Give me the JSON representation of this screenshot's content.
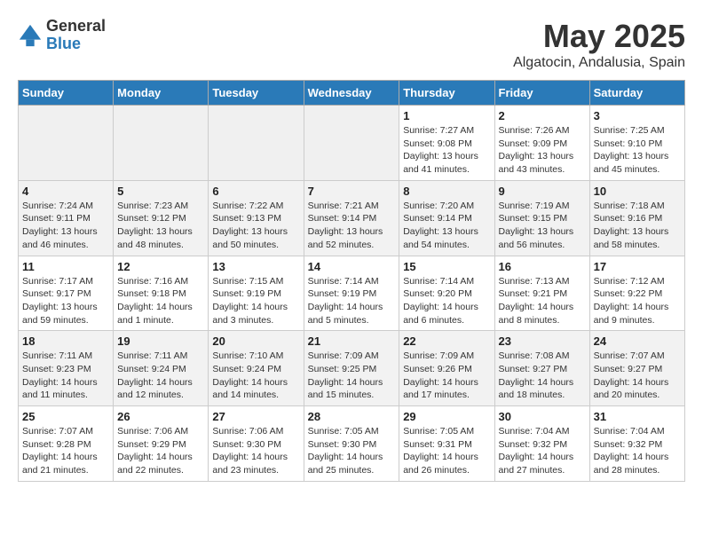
{
  "header": {
    "logo_general": "General",
    "logo_blue": "Blue",
    "month_title": "May 2025",
    "location": "Algatocin, Andalusia, Spain"
  },
  "days_of_week": [
    "Sunday",
    "Monday",
    "Tuesday",
    "Wednesday",
    "Thursday",
    "Friday",
    "Saturday"
  ],
  "weeks": [
    [
      {
        "day": "",
        "info": ""
      },
      {
        "day": "",
        "info": ""
      },
      {
        "day": "",
        "info": ""
      },
      {
        "day": "",
        "info": ""
      },
      {
        "day": "1",
        "info": "Sunrise: 7:27 AM\nSunset: 9:08 PM\nDaylight: 13 hours\nand 41 minutes."
      },
      {
        "day": "2",
        "info": "Sunrise: 7:26 AM\nSunset: 9:09 PM\nDaylight: 13 hours\nand 43 minutes."
      },
      {
        "day": "3",
        "info": "Sunrise: 7:25 AM\nSunset: 9:10 PM\nDaylight: 13 hours\nand 45 minutes."
      }
    ],
    [
      {
        "day": "4",
        "info": "Sunrise: 7:24 AM\nSunset: 9:11 PM\nDaylight: 13 hours\nand 46 minutes."
      },
      {
        "day": "5",
        "info": "Sunrise: 7:23 AM\nSunset: 9:12 PM\nDaylight: 13 hours\nand 48 minutes."
      },
      {
        "day": "6",
        "info": "Sunrise: 7:22 AM\nSunset: 9:13 PM\nDaylight: 13 hours\nand 50 minutes."
      },
      {
        "day": "7",
        "info": "Sunrise: 7:21 AM\nSunset: 9:14 PM\nDaylight: 13 hours\nand 52 minutes."
      },
      {
        "day": "8",
        "info": "Sunrise: 7:20 AM\nSunset: 9:14 PM\nDaylight: 13 hours\nand 54 minutes."
      },
      {
        "day": "9",
        "info": "Sunrise: 7:19 AM\nSunset: 9:15 PM\nDaylight: 13 hours\nand 56 minutes."
      },
      {
        "day": "10",
        "info": "Sunrise: 7:18 AM\nSunset: 9:16 PM\nDaylight: 13 hours\nand 58 minutes."
      }
    ],
    [
      {
        "day": "11",
        "info": "Sunrise: 7:17 AM\nSunset: 9:17 PM\nDaylight: 13 hours\nand 59 minutes."
      },
      {
        "day": "12",
        "info": "Sunrise: 7:16 AM\nSunset: 9:18 PM\nDaylight: 14 hours\nand 1 minute."
      },
      {
        "day": "13",
        "info": "Sunrise: 7:15 AM\nSunset: 9:19 PM\nDaylight: 14 hours\nand 3 minutes."
      },
      {
        "day": "14",
        "info": "Sunrise: 7:14 AM\nSunset: 9:19 PM\nDaylight: 14 hours\nand 5 minutes."
      },
      {
        "day": "15",
        "info": "Sunrise: 7:14 AM\nSunset: 9:20 PM\nDaylight: 14 hours\nand 6 minutes."
      },
      {
        "day": "16",
        "info": "Sunrise: 7:13 AM\nSunset: 9:21 PM\nDaylight: 14 hours\nand 8 minutes."
      },
      {
        "day": "17",
        "info": "Sunrise: 7:12 AM\nSunset: 9:22 PM\nDaylight: 14 hours\nand 9 minutes."
      }
    ],
    [
      {
        "day": "18",
        "info": "Sunrise: 7:11 AM\nSunset: 9:23 PM\nDaylight: 14 hours\nand 11 minutes."
      },
      {
        "day": "19",
        "info": "Sunrise: 7:11 AM\nSunset: 9:24 PM\nDaylight: 14 hours\nand 12 minutes."
      },
      {
        "day": "20",
        "info": "Sunrise: 7:10 AM\nSunset: 9:24 PM\nDaylight: 14 hours\nand 14 minutes."
      },
      {
        "day": "21",
        "info": "Sunrise: 7:09 AM\nSunset: 9:25 PM\nDaylight: 14 hours\nand 15 minutes."
      },
      {
        "day": "22",
        "info": "Sunrise: 7:09 AM\nSunset: 9:26 PM\nDaylight: 14 hours\nand 17 minutes."
      },
      {
        "day": "23",
        "info": "Sunrise: 7:08 AM\nSunset: 9:27 PM\nDaylight: 14 hours\nand 18 minutes."
      },
      {
        "day": "24",
        "info": "Sunrise: 7:07 AM\nSunset: 9:27 PM\nDaylight: 14 hours\nand 20 minutes."
      }
    ],
    [
      {
        "day": "25",
        "info": "Sunrise: 7:07 AM\nSunset: 9:28 PM\nDaylight: 14 hours\nand 21 minutes."
      },
      {
        "day": "26",
        "info": "Sunrise: 7:06 AM\nSunset: 9:29 PM\nDaylight: 14 hours\nand 22 minutes."
      },
      {
        "day": "27",
        "info": "Sunrise: 7:06 AM\nSunset: 9:30 PM\nDaylight: 14 hours\nand 23 minutes."
      },
      {
        "day": "28",
        "info": "Sunrise: 7:05 AM\nSunset: 9:30 PM\nDaylight: 14 hours\nand 25 minutes."
      },
      {
        "day": "29",
        "info": "Sunrise: 7:05 AM\nSunset: 9:31 PM\nDaylight: 14 hours\nand 26 minutes."
      },
      {
        "day": "30",
        "info": "Sunrise: 7:04 AM\nSunset: 9:32 PM\nDaylight: 14 hours\nand 27 minutes."
      },
      {
        "day": "31",
        "info": "Sunrise: 7:04 AM\nSunset: 9:32 PM\nDaylight: 14 hours\nand 28 minutes."
      }
    ]
  ]
}
